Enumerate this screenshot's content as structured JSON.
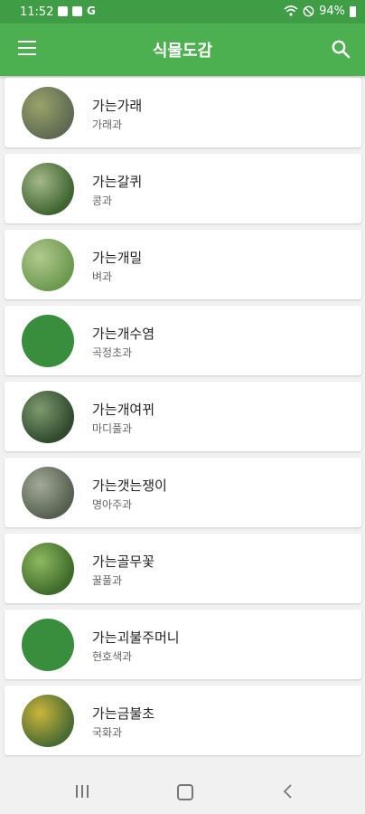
{
  "status_bar": {
    "time": "11:52",
    "g_label": "G",
    "battery_text": "94%"
  },
  "app_bar": {
    "title": "식물도감",
    "menu_icon": "hamburger-menu-icon",
    "search_icon": "search-icon"
  },
  "plants": [
    {
      "name": "가는가래",
      "family": "가래과",
      "thumb": "photo",
      "colors": [
        "#5f6a52",
        "#9aa36a"
      ]
    },
    {
      "name": "가는갈퀴",
      "family": "콩과",
      "thumb": "photo",
      "colors": [
        "#3f6530",
        "#a4b889"
      ]
    },
    {
      "name": "가는개밀",
      "family": "벼과",
      "thumb": "photo",
      "colors": [
        "#6c9a4e",
        "#b3c98e"
      ]
    },
    {
      "name": "가는개수염",
      "family": "곡정초과",
      "thumb": "placeholder",
      "colors": [
        "#388e3c",
        "#388e3c"
      ]
    },
    {
      "name": "가는개여뀌",
      "family": "마디풀과",
      "thumb": "photo",
      "colors": [
        "#2f4a2c",
        "#7e9a6f"
      ]
    },
    {
      "name": "가는갯는쟁이",
      "family": "명아주과",
      "thumb": "photo",
      "colors": [
        "#55604f",
        "#a3a999"
      ]
    },
    {
      "name": "가는골무꽃",
      "family": "꿀풀과",
      "thumb": "photo",
      "colors": [
        "#3e6b2a",
        "#8fb860"
      ]
    },
    {
      "name": "가는괴불주머니",
      "family": "현호색과",
      "thumb": "placeholder",
      "colors": [
        "#388e3c",
        "#388e3c"
      ]
    },
    {
      "name": "가는금불초",
      "family": "국화과",
      "thumb": "photo",
      "colors": [
        "#4a6b33",
        "#c9b53a"
      ]
    }
  ],
  "nav_bar": {
    "recents_icon": "recent-apps-icon",
    "home_icon": "home-icon",
    "back_icon": "back-icon"
  },
  "colors": {
    "status_bar": "#3f9e45",
    "app_bar": "#4caf50",
    "placeholder_circle": "#388e3c",
    "background": "#f1f1f1"
  }
}
